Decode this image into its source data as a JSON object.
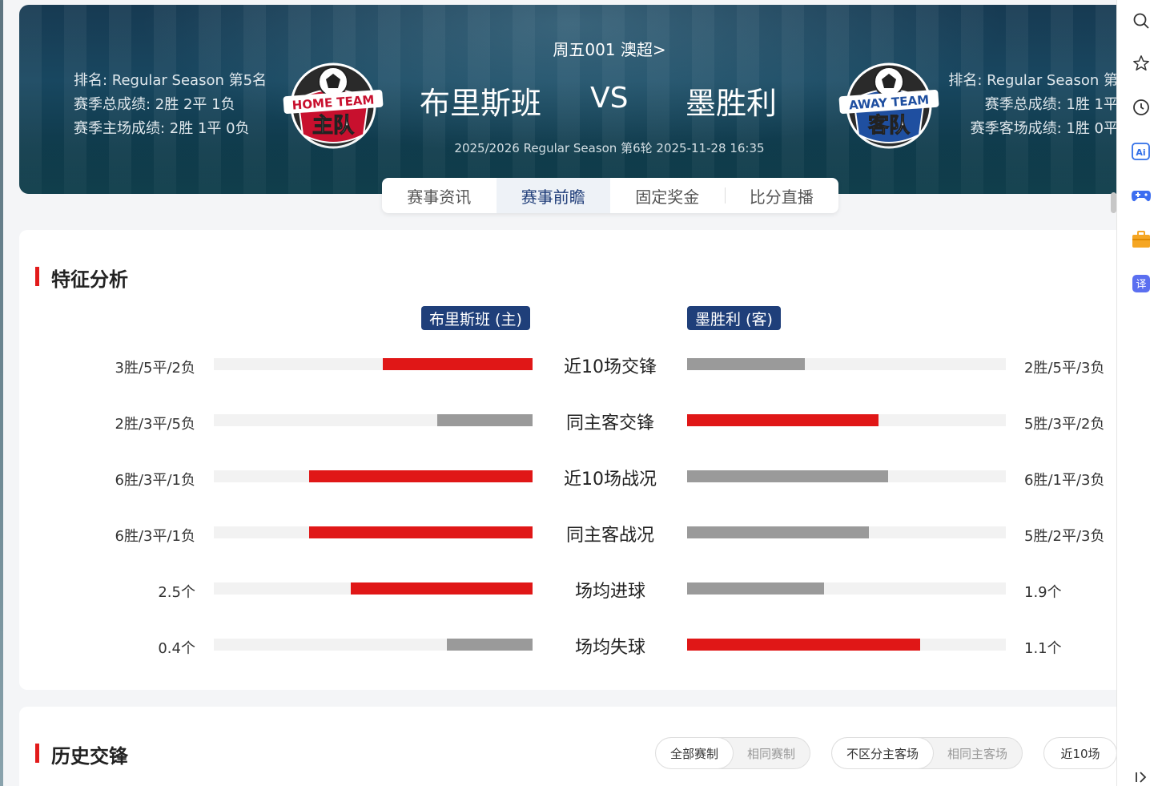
{
  "header": {
    "league": "周五001 澳超>",
    "home_name": "布里斯班",
    "vs": "VS",
    "away_name": "墨胜利",
    "season_info": "2025/2026 Regular Season 第6轮 2025-11-28 16:35",
    "home_stats": [
      "排名: Regular Season 第5名",
      "赛季总成绩: 2胜 2平 1负",
      "赛季主场成绩: 2胜 1平 0负"
    ],
    "away_stats": [
      "排名: Regular Season 第",
      "赛季总成绩: 1胜 1平",
      "赛季客场成绩: 1胜 0平"
    ],
    "home_logo_text": [
      "HOME TEAM",
      "主队"
    ],
    "away_logo_text": [
      "AWAY TEAM",
      "客队"
    ]
  },
  "tabs": [
    {
      "label": "赛事资讯",
      "active": false
    },
    {
      "label": "赛事前瞻",
      "active": true
    },
    {
      "label": "固定奖金",
      "active": false
    },
    {
      "label": "比分直播",
      "active": false
    }
  ],
  "features": {
    "title": "特征分析",
    "home_chip": "布里斯班 (主)",
    "away_chip": "墨胜利 (客)",
    "rows": [
      {
        "label": "近10场交锋",
        "home_text": "3胜/5平/2负",
        "away_text": "2胜/5平/3负",
        "home_fraction": 0.47,
        "away_fraction": 0.37,
        "home_color": "red",
        "away_color": "gray"
      },
      {
        "label": "同主客交锋",
        "home_text": "2胜/3平/5负",
        "away_text": "5胜/3平/2负",
        "home_fraction": 0.3,
        "away_fraction": 0.6,
        "home_color": "gray",
        "away_color": "red"
      },
      {
        "label": "近10场战况",
        "home_text": "6胜/3平/1负",
        "away_text": "6胜/1平/3负",
        "home_fraction": 0.7,
        "away_fraction": 0.63,
        "home_color": "red",
        "away_color": "gray"
      },
      {
        "label": "同主客战况",
        "home_text": "6胜/3平/1负",
        "away_text": "5胜/2平/3负",
        "home_fraction": 0.7,
        "away_fraction": 0.57,
        "home_color": "red",
        "away_color": "gray"
      },
      {
        "label": "场均进球",
        "home_text": "2.5个",
        "away_text": "1.9个",
        "home_fraction": 0.57,
        "away_fraction": 0.43,
        "home_color": "red",
        "away_color": "gray"
      },
      {
        "label": "场均失球",
        "home_text": "0.4个",
        "away_text": "1.1个",
        "home_fraction": 0.27,
        "away_fraction": 0.73,
        "home_color": "gray",
        "away_color": "red"
      }
    ]
  },
  "history": {
    "title": "历史交锋",
    "filter_groups": [
      [
        {
          "label": "全部赛制",
          "active": true
        },
        {
          "label": "相同赛制",
          "active": false
        }
      ],
      [
        {
          "label": "不区分主客场",
          "active": true
        },
        {
          "label": "相同主客场",
          "active": false
        }
      ],
      [
        {
          "label": "近10场",
          "active": true
        }
      ]
    ]
  },
  "sidebar": {
    "icons": [
      "search-icon",
      "star-icon",
      "history-icon",
      "ai-icon",
      "gamepad-icon",
      "briefcase-icon",
      "translate-icon",
      "collapse-icon"
    ],
    "ai_label": "Ai",
    "translate_label": "译"
  },
  "colors": {
    "accent_red": "#e01717",
    "navy": "#1f3f7a",
    "bar_gray": "#9a9a9a"
  }
}
